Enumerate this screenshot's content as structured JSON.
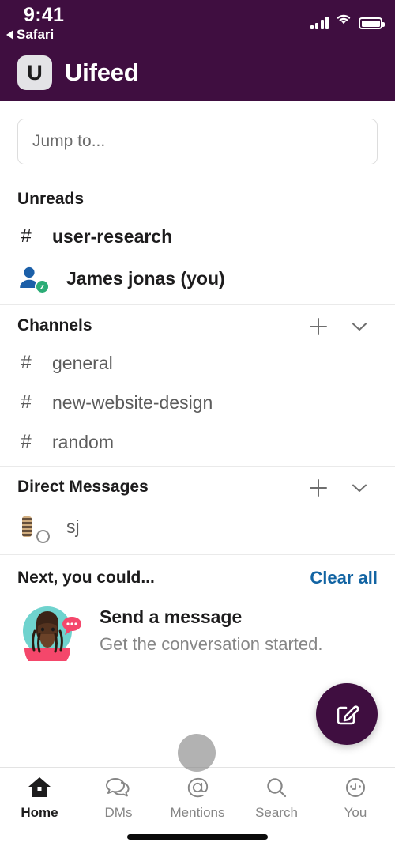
{
  "status_bar": {
    "time": "9:41",
    "back_app": "Safari",
    "signal_icon": "cellular-signal-icon",
    "wifi_icon": "wifi-icon",
    "battery_icon": "battery-full-icon"
  },
  "header": {
    "logo_letter": "U",
    "workspace_name": "Uifeed",
    "background_color": "#3F0E40"
  },
  "search": {
    "placeholder": "Jump to...",
    "value": ""
  },
  "unreads": {
    "title": "Unreads",
    "items": [
      {
        "icon": "hash-icon",
        "prefix": "#",
        "label": "user-research"
      },
      {
        "icon": "person-away-icon",
        "prefix": "",
        "label": "James jonas (you)",
        "status": "away"
      }
    ]
  },
  "channels": {
    "title": "Channels",
    "add_icon": "plus-icon",
    "collapse_icon": "chevron-down-icon",
    "items": [
      {
        "prefix": "#",
        "label": "general"
      },
      {
        "prefix": "#",
        "label": "new-website-design"
      },
      {
        "prefix": "#",
        "label": "random"
      }
    ]
  },
  "direct_messages": {
    "title": "Direct Messages",
    "add_icon": "plus-icon",
    "collapse_icon": "chevron-down-icon",
    "items": [
      {
        "label": "sj",
        "status": "offline"
      }
    ]
  },
  "suggestions": {
    "title": "Next, you could...",
    "clear_all_label": "Clear all",
    "clear_all_color": "#1264A3",
    "cards": [
      {
        "title": "Send a message",
        "subtitle": "Get the conversation started.",
        "illustration": "person-with-speech-bubble-illustration"
      }
    ]
  },
  "compose_button": {
    "icon": "compose-pencil-icon",
    "color": "#3F0E40"
  },
  "tabbar": {
    "items": [
      {
        "icon": "home-icon",
        "label": "Home",
        "active": true
      },
      {
        "icon": "dms-chat-icon",
        "label": "DMs",
        "active": false
      },
      {
        "icon": "mentions-at-icon",
        "label": "Mentions",
        "active": false
      },
      {
        "icon": "search-icon",
        "label": "Search",
        "active": false
      },
      {
        "icon": "you-face-icon",
        "label": "You",
        "active": false
      }
    ]
  }
}
